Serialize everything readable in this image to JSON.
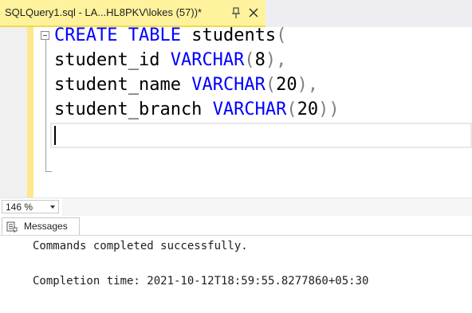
{
  "tab": {
    "title": "SQLQuery1.sql - LA...HL8PKV\\lokes (57))*",
    "pin_icon": "pin-icon",
    "close_icon": "close-icon"
  },
  "editor": {
    "lines": [
      {
        "kw1": "CREATE",
        "kw2": "TABLE",
        "ident": "students",
        "open": "("
      },
      {
        "ident": "student_id",
        "kw": "VARCHAR",
        "open": "(",
        "num": "8",
        "close": ")",
        "tail": ","
      },
      {
        "ident": "student_name",
        "kw": "VARCHAR",
        "open": "(",
        "num": "20",
        "close": ")",
        "tail": ","
      },
      {
        "ident": "student_branch",
        "kw": "VARCHAR",
        "open": "(",
        "num": "20",
        "close": ")",
        "close2": ")"
      }
    ]
  },
  "zoom": {
    "value": "146 %"
  },
  "results_tab": {
    "label": "Messages",
    "icon": "messages-icon"
  },
  "messages": [
    "Commands completed successfully.",
    "Completion time: 2021-10-12T18:59:55.8277860+05:30"
  ],
  "colors": {
    "keyword": "#0000ff",
    "paren": "#808080",
    "tab_active": "#fff29d",
    "indicator": "#fbe98b"
  }
}
